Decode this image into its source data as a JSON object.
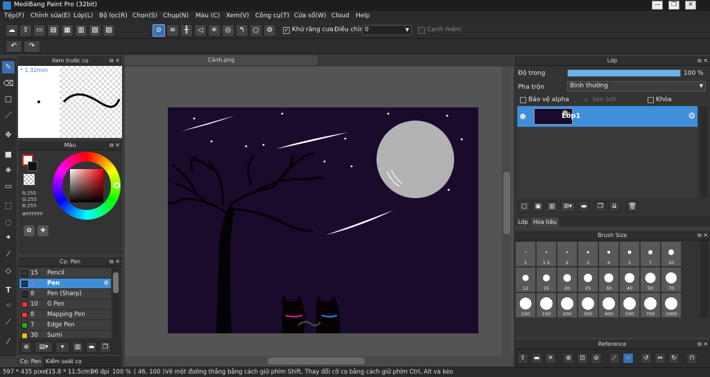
{
  "titlebar": {
    "title": "MediBang Paint Pro (32bit)",
    "min": "—",
    "max": "❐",
    "close": "✕"
  },
  "menu": [
    "Tệp(F)",
    "Chỉnh sửa(E)",
    "Lớp(L)",
    "Bộ lọc(R)",
    "Chọn(S)",
    "Chụp(N)",
    "Màu (C)",
    "Xem(V)",
    "Công cụ(T)",
    "Cửa sổ(W)",
    "Cloud",
    "Help"
  ],
  "toolbar": {
    "antialias_label": "Khử răng cưa",
    "adjust_label": "Điều chỉnh",
    "adjust_value": "0",
    "edge_label": "Cạnh mềm"
  },
  "brush_preview": {
    "title": "Xem trước cọ",
    "size": "* 1.32mm"
  },
  "color_panel": {
    "title": "Màu",
    "r": "R:255",
    "g": "G:255",
    "b": "B:255",
    "hex": "#FFFFFF"
  },
  "brush_panel": {
    "title": "Cọ: Pen",
    "items": [
      {
        "size": "15",
        "name": "Pencil",
        "color": "#3a3a3a"
      },
      {
        "size": "5",
        "name": "Pen",
        "color": "#1f3a5f"
      },
      {
        "size": "8",
        "name": "Pen (Sharp)",
        "color": "#2a2a2a"
      },
      {
        "size": "10",
        "name": "G Pen",
        "color": "#e23a3a"
      },
      {
        "size": "8",
        "name": "Mapping Pen",
        "color": "#e23a3a"
      },
      {
        "size": "7",
        "name": "Edge Pen",
        "color": "#27a827"
      },
      {
        "size": "30",
        "name": "Sumi",
        "color": "#e6c21e"
      }
    ],
    "tab1": "Cọ: Pen",
    "tab2": "Kiểm soát cọ"
  },
  "canvas": {
    "tab": "Cảnh.png"
  },
  "layer_panel": {
    "title": "Lớp",
    "opacity_label": "Độ trong",
    "opacity_value": "100 %",
    "opacity": 1.0,
    "blend_label": "Pha trộn",
    "blend_value": "Bình thường",
    "protect_alpha": "Bảo vệ alpha",
    "clipping": "Xén bớt",
    "lock": "Khóa",
    "layer_name": "Lớp1",
    "tab1": "Lớp",
    "tab2": "Hoa tiêu"
  },
  "brush_size": {
    "title": "Brush Size",
    "sizes": [
      "1",
      "1.5",
      "2",
      "3",
      "4",
      "5",
      "7",
      "10",
      "12",
      "15",
      "20",
      "25",
      "30",
      "40",
      "50",
      "70",
      "100",
      "150",
      "200",
      "300",
      "400",
      "500",
      "700",
      "1000"
    ]
  },
  "reference": {
    "title": "Reference"
  },
  "status": {
    "dims": "597 * 435 pixel",
    "cm": "(15.8 * 11.5cm)",
    "dpi": "96 dpi",
    "zoom": "100 %",
    "coord": "( 46, 100 )",
    "hint": "Vẽ một đường thẳng bằng cách giữ phím Shift, Thay đổi cỡ cọ bằng cách giữ phím Ctrl, Alt và kéo"
  }
}
